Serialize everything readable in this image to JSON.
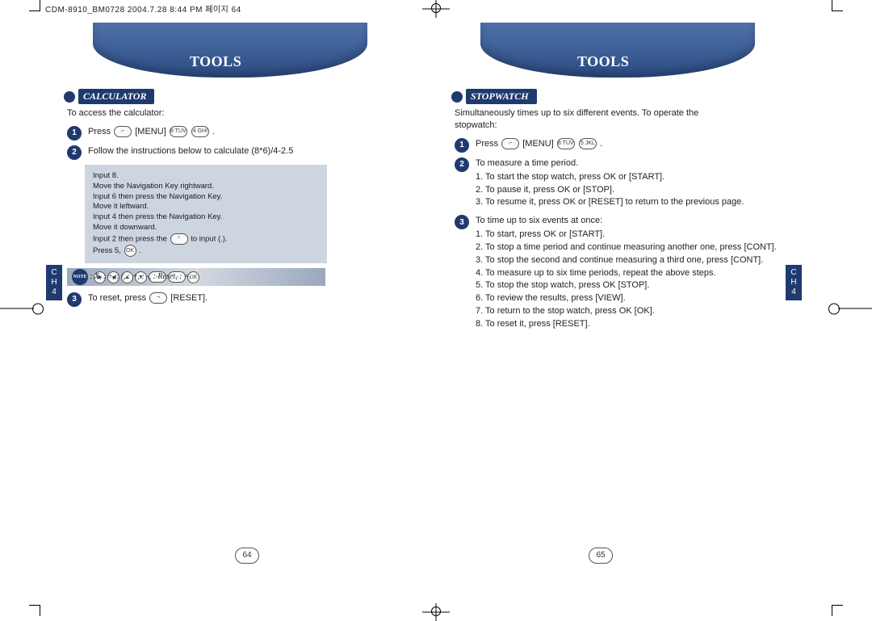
{
  "print_header": "CDM-8910_BM0728  2004.7.28 8:44 PM  페이지 64",
  "chapter_tab": {
    "line1": "C",
    "line2": "H",
    "line3": "4"
  },
  "left": {
    "title": "TOOLS",
    "section": "CALCULATOR",
    "intro": "To access the calculator:",
    "step1_a": "Press",
    "step1_b": "[MENU]",
    "step1_c": ".",
    "key_8": "8 TUV",
    "key_4": "4 GHI",
    "step2": "Follow the instructions below to calculate (8*6)/4-2.5",
    "tint_l1": "Input 8.",
    "tint_l2": "Move the Navigation Key rightward.",
    "tint_l3": "Input 6 then press the Navigation Key.",
    "tint_l4": "Move it leftward.",
    "tint_l5": "Input 4 then press the Navigation Key.",
    "tint_l6": "Move it downward.",
    "tint_l7": "Input 2 then press the",
    "tint_l7b": "to input (.).",
    "tint_l8a": "Press 5,",
    "tint_l8b": ".",
    "note_badge": "NOTE",
    "note_text": " : X,   : ÷,   : /,   : +,   : -,   : Reset,   : =.",
    "step3_a": "To reset, press",
    "step3_b": "[RESET].",
    "pagenum": "64"
  },
  "right": {
    "title": "TOOLS",
    "section": "STOPWATCH",
    "intro": "Simultaneously times up to six different events. To operate the stopwatch:",
    "step1_a": "Press",
    "step1_b": "[MENU]",
    "step1_c": ".",
    "key_8": "8 TUV",
    "key_5": "5 JKL",
    "step2_title": "To measure a time period.",
    "step2_items": [
      "1. To start the stop watch, press  OK  or   [START].",
      "2. To pause it, press  OK  or   [STOP].",
      "3. To resume it, press  OK  or   [RESET] to return to the previous page."
    ],
    "step3_title": "To time up to six events at once:",
    "step3_items": [
      "1. To start, press  OK  or   [START].",
      "2. To stop a time period and continue measuring another one, press   [CONT].",
      "3. To stop the second and continue measuring a third one, press   [CONT].",
      "4. To measure up to six time periods, repeat the above steps.",
      "5. To stop the stop watch, press  OK  [STOP].",
      "6. To review the results, press   [VIEW].",
      "7. To return to the stop watch, press  OK  [OK].",
      "8. To reset it, press   [RESET]."
    ],
    "pagenum": "65"
  }
}
